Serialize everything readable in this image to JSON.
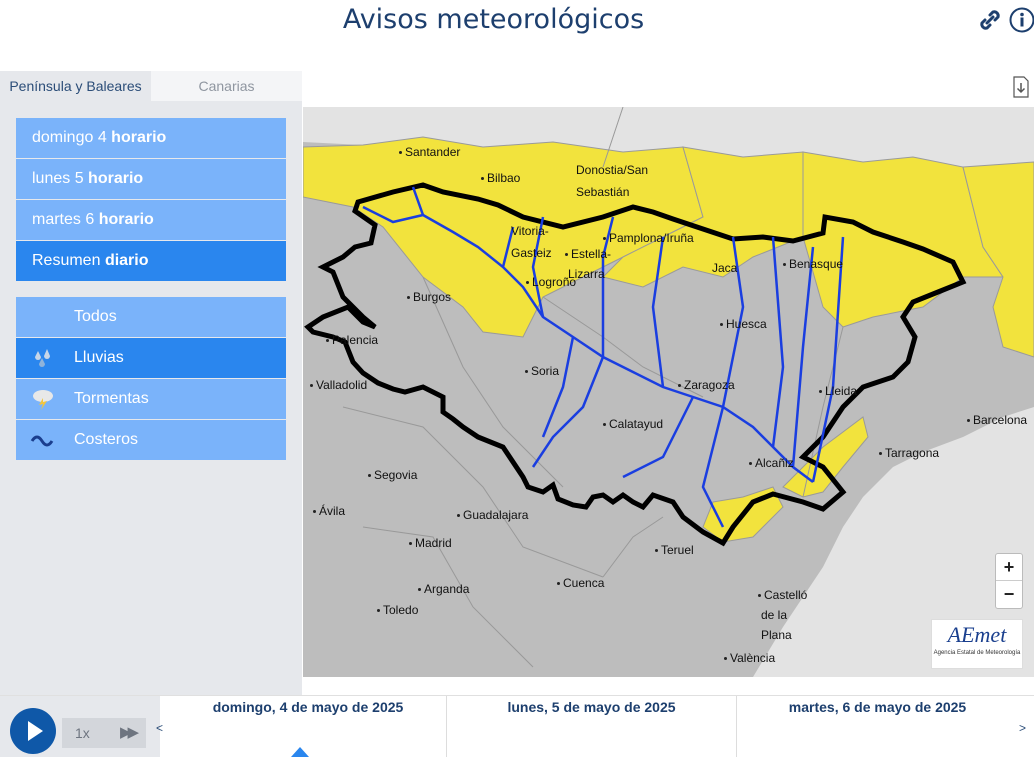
{
  "header": {
    "title": "Avisos meteorológicos",
    "link_icon": "link-icon",
    "info_icon": "info-icon"
  },
  "tabs": [
    {
      "label": "Península y Baleares",
      "active": true
    },
    {
      "label": "Canarias",
      "active": false
    }
  ],
  "days": [
    {
      "day": "domingo 4",
      "mode": "horario",
      "active": false
    },
    {
      "day": "lunes 5",
      "mode": "horario",
      "active": false
    },
    {
      "day": "martes 6",
      "mode": "horario",
      "active": false
    },
    {
      "day": "Resumen",
      "mode": "diario",
      "active": true
    }
  ],
  "phenomena": [
    {
      "label": "Todos",
      "icon": "none",
      "active": false
    },
    {
      "label": "Lluvias",
      "icon": "rain-icon",
      "active": true
    },
    {
      "label": "Tormentas",
      "icon": "storm-icon",
      "active": false
    },
    {
      "label": "Costeros",
      "icon": "wave-icon",
      "active": false
    }
  ],
  "map": {
    "colors": {
      "land": "#bdbdbd",
      "warning_yellow": "#f2e33d",
      "rivers": "#1a3ee0",
      "basin_border": "#000000"
    },
    "cities": [
      "Santander",
      "Bilbao",
      "Donostia/San",
      "Sebastián",
      "Vitoria-",
      "Gasteiz",
      "Pamplona/Iruña",
      "Estella-",
      "Lizarra",
      "Logroño",
      "Jaca",
      "Benasque",
      "Burgos",
      "Huesca",
      "Palencia",
      "Soria",
      "Zaragoza",
      "Valladolid",
      "Lleida",
      "Barcelona",
      "Calatayud",
      "Tarragona",
      "Alcañiz",
      "Segovia",
      "Ávila",
      "Guadalajara",
      "Madrid",
      "Teruel",
      "Arganda",
      "Cuenca",
      "Castelló",
      "de la",
      "Plana",
      "Toledo",
      "València"
    ],
    "zoom_in": "+",
    "zoom_out": "−",
    "logo_text": "AEmet",
    "logo_subtext": "Agencia Estatal de Meteorología"
  },
  "player": {
    "speed": "1x",
    "prev": "<",
    "next": ">"
  },
  "timeline": [
    {
      "label": "domingo, 4 de mayo de 2025"
    },
    {
      "label": "lunes, 5 de mayo de 2025"
    },
    {
      "label": "martes, 6 de mayo de 2025"
    }
  ]
}
